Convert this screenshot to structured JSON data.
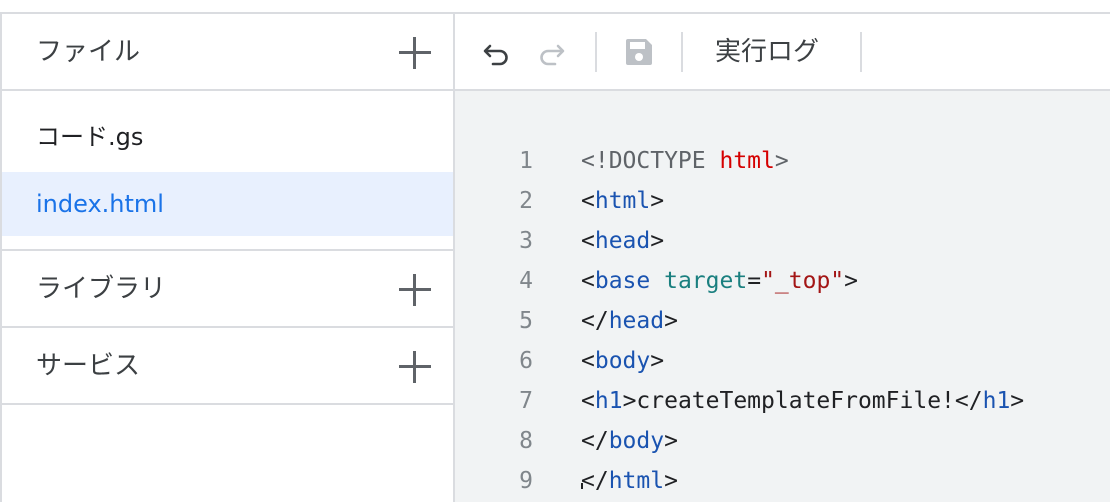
{
  "sidebar": {
    "files_title": "ファイル",
    "files": [
      {
        "name": "コード.gs"
      },
      {
        "name": "index.html",
        "selected": true
      }
    ],
    "libraries_title": "ライブラリ",
    "services_title": "サービス"
  },
  "toolbar": {
    "undo_icon": "undo-icon",
    "redo_icon": "redo-icon",
    "save_icon": "save-icon",
    "exec_log_label": "実行ログ"
  },
  "editor": {
    "line_numbers": [
      "1",
      "2",
      "3",
      "4",
      "5",
      "6",
      "7",
      "8",
      "9"
    ],
    "lines": [
      {
        "parts": [
          {
            "t": "<!DOCTYPE ",
            "c": "doctype"
          },
          {
            "t": "html",
            "c": "doctype-kw"
          },
          {
            "t": ">",
            "c": "doctype"
          }
        ]
      },
      {
        "parts": [
          {
            "t": "<",
            "c": "plain"
          },
          {
            "t": "html",
            "c": "tag"
          },
          {
            "t": ">",
            "c": "plain"
          }
        ]
      },
      {
        "parts": [
          {
            "t": "<",
            "c": "plain"
          },
          {
            "t": "head",
            "c": "tag"
          },
          {
            "t": ">",
            "c": "plain"
          }
        ]
      },
      {
        "parts": [
          {
            "t": "<",
            "c": "plain"
          },
          {
            "t": "base",
            "c": "tag"
          },
          {
            "t": " ",
            "c": "plain"
          },
          {
            "t": "target",
            "c": "attr"
          },
          {
            "t": "=",
            "c": "plain"
          },
          {
            "t": "\"_top\"",
            "c": "str"
          },
          {
            "t": ">",
            "c": "plain"
          }
        ]
      },
      {
        "parts": [
          {
            "t": "</",
            "c": "plain"
          },
          {
            "t": "head",
            "c": "tag"
          },
          {
            "t": ">",
            "c": "plain"
          }
        ]
      },
      {
        "parts": [
          {
            "t": "<",
            "c": "plain"
          },
          {
            "t": "body",
            "c": "tag"
          },
          {
            "t": ">",
            "c": "plain"
          }
        ]
      },
      {
        "parts": [
          {
            "t": "<",
            "c": "plain"
          },
          {
            "t": "h1",
            "c": "tag"
          },
          {
            "t": ">createTemplateFromFile!</",
            "c": "plain"
          },
          {
            "t": "h1",
            "c": "tag"
          },
          {
            "t": ">",
            "c": "plain"
          }
        ]
      },
      {
        "parts": [
          {
            "t": "</",
            "c": "plain"
          },
          {
            "t": "body",
            "c": "tag"
          },
          {
            "t": ">",
            "c": "plain"
          }
        ]
      },
      {
        "parts": [
          {
            "t": "</",
            "c": "plain"
          },
          {
            "t": "html",
            "c": "tag"
          },
          {
            "t": ">",
            "c": "plain"
          }
        ]
      }
    ]
  },
  "colors": {
    "selected_bg": "#e8f0fe",
    "selected_text": "#1a73e8",
    "tag": "#1a53b0",
    "doctype_keyword": "#d50000",
    "attribute": "#1a7f7f",
    "string": "#a31515",
    "code_bg": "#f1f3f4",
    "border": "#dadce0"
  }
}
